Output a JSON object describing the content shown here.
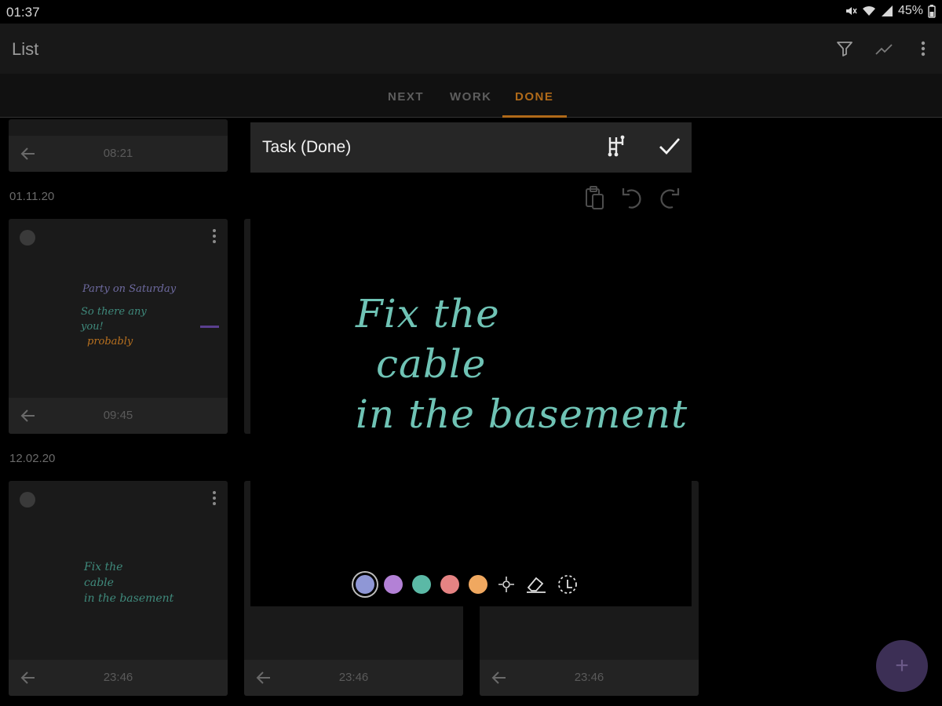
{
  "status": {
    "time": "01:37",
    "battery": "45%"
  },
  "appbar": {
    "title": "List"
  },
  "tabs": [
    {
      "label": "NEXT",
      "active": false
    },
    {
      "label": "WORK",
      "active": false
    },
    {
      "label": "DONE",
      "active": true
    }
  ],
  "sections": [
    {
      "date": "01.11.20"
    },
    {
      "date": "12.02.20"
    }
  ],
  "cards": {
    "top_row_time": "08:21",
    "middle_left": {
      "time": "09:45",
      "note_lines": [
        "Party on Saturday",
        "So there any",
        "you!",
        "probably"
      ]
    },
    "bottom_left": {
      "time": "23:46",
      "note_lines": [
        "Fix the",
        "cable",
        "in the basement"
      ]
    },
    "bottom_middle": {
      "time": "23:46"
    },
    "bottom_right": {
      "time": "23:46"
    }
  },
  "dialog": {
    "title": "Task (Done)",
    "note_lines": [
      "Fix the",
      "cable",
      "in the basement"
    ],
    "ink_color": "#6fc3b5",
    "palette": [
      "#8f97d6",
      "#b381d6",
      "#5bb9a6",
      "#e58383",
      "#f0a860"
    ]
  },
  "colors": {
    "accent": "#b06a19",
    "fab": "#3c2f55"
  }
}
